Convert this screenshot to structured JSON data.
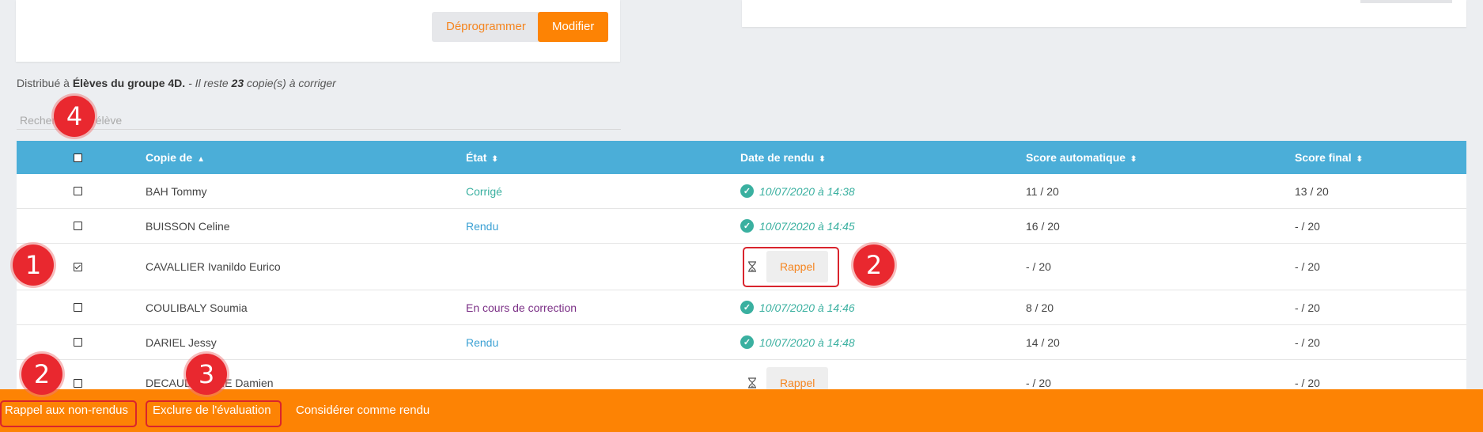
{
  "top_card": {
    "unschedule_label": "Déprogrammer",
    "edit_label": "Modifier"
  },
  "distribution": {
    "prefix": "Distribué à ",
    "group": "Élèves du groupe 4D.",
    "remaining_prefix": " - Il reste ",
    "remaining_count": "23",
    "remaining_suffix": " copie(s) à corriger"
  },
  "search": {
    "placeholder": "Rechercher un élève"
  },
  "table": {
    "headers": {
      "copy_of": "Copie de",
      "state": "État",
      "date": "Date de rendu",
      "auto_score": "Score automatique",
      "final_score": "Score final"
    },
    "rows": [
      {
        "name": "BAH Tommy",
        "state": "Corrigé",
        "date": "10/07/2020 à 14:38",
        "auto": "11 / 20",
        "final": "13 / 20",
        "checked": false
      },
      {
        "name": "BUISSON Celine",
        "state": "Rendu",
        "date": "10/07/2020 à 14:45",
        "auto": "16 / 20",
        "final": "- / 20",
        "checked": false
      },
      {
        "name": "CAVALLIER Ivanildo Eurico",
        "state": "",
        "date": "",
        "reminder": "Rappel",
        "auto": "- / 20",
        "final": "- / 20",
        "checked": true
      },
      {
        "name": "COULIBALY Soumia",
        "state": "En cours de correction",
        "date": "10/07/2020 à 14:46",
        "auto": "8 / 20",
        "final": "- / 20",
        "checked": false
      },
      {
        "name": "DARIEL Jessy",
        "state": "Rendu",
        "date": "10/07/2020 à 14:48",
        "auto": "14 / 20",
        "final": "- / 20",
        "checked": false
      },
      {
        "name": "DECAUDAVEINE Damien",
        "state": "",
        "date": "",
        "reminder": "Rappel",
        "auto": "- / 20",
        "final": "- / 20",
        "checked": false
      }
    ]
  },
  "bottom_bar": {
    "remind_label": "Rappel aux non-rendus",
    "exclude_label": "Exclure de l'évaluation",
    "consider_label": "Considérer comme rendu"
  },
  "markers": {
    "m1": "1",
    "m2a": "2",
    "m2b": "2",
    "m3": "3",
    "m4": "4"
  },
  "colors": {
    "accent_orange": "#fd8304",
    "header_blue": "#4baed8",
    "state_green": "#3ab0a0",
    "state_blue": "#3aa0d3",
    "state_purple": "#7b2f86",
    "annotation_red": "#e9282f"
  }
}
